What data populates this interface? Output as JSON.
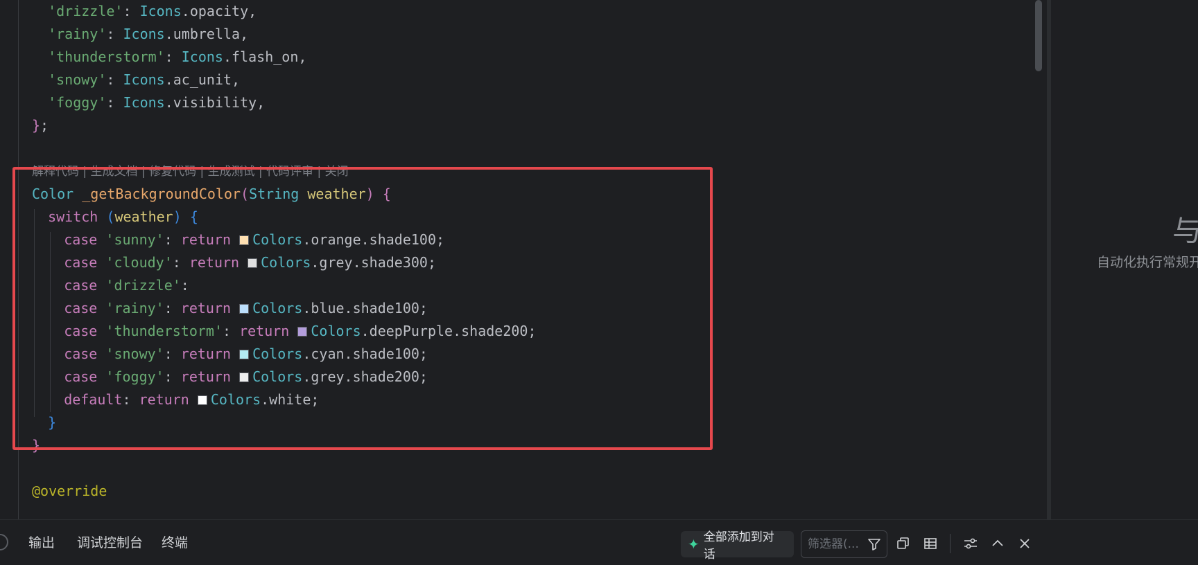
{
  "editor": {
    "codelens": "解释代码 | 生成文档 | 修复代码 | 生成测试 | 代码评审 | 关闭",
    "top_entries": [
      {
        "key": "'drizzle'",
        "cls": "Icons",
        "member": "opacity"
      },
      {
        "key": "'rainy'",
        "cls": "Icons",
        "member": "umbrella"
      },
      {
        "key": "'thunderstorm'",
        "cls": "Icons",
        "member": "flash_on"
      },
      {
        "key": "'snowy'",
        "cls": "Icons",
        "member": "ac_unit"
      },
      {
        "key": "'foggy'",
        "cls": "Icons",
        "member": "visibility"
      }
    ],
    "map_close": "};",
    "func": {
      "ret_type": "Color",
      "name": "_getBackgroundColor",
      "param_type": "String",
      "param_name": "weather"
    },
    "switch_kw": "switch",
    "switch_arg": "weather",
    "case_kw": "case",
    "return_kw": "return",
    "default_kw": "default",
    "cases": [
      {
        "label": "'sunny'",
        "has_return": true,
        "swatch": "#ffe0b2",
        "cls": "Colors",
        "member": "orange.shade100;"
      },
      {
        "label": "'cloudy'",
        "has_return": true,
        "swatch": "#e0e0e0",
        "cls": "Colors",
        "member": "grey.shade300;"
      },
      {
        "label": "'drizzle'",
        "has_return": false
      },
      {
        "label": "'rainy'",
        "has_return": true,
        "swatch": "#bbdefb",
        "cls": "Colors",
        "member": "blue.shade100;"
      },
      {
        "label": "'thunderstorm'",
        "has_return": true,
        "swatch": "#b39ddb",
        "cls": "Colors",
        "member": "deepPurple.shade200;"
      },
      {
        "label": "'snowy'",
        "has_return": true,
        "swatch": "#b2ebf2",
        "cls": "Colors",
        "member": "cyan.shade100;"
      },
      {
        "label": "'foggy'",
        "has_return": true,
        "swatch": "#eeeeee",
        "cls": "Colors",
        "member": "grey.shade200;"
      }
    ],
    "default_case": {
      "swatch": "#ffffff",
      "cls": "Colors",
      "member": "white;"
    },
    "annotation": "@override"
  },
  "right_panel": {
    "big_char": "与",
    "subtitle": "自动化执行常规开"
  },
  "bottom": {
    "tabs": [
      "输出",
      "调试控制台",
      "终端"
    ],
    "add_all_label": "全部添加到对话",
    "filter_placeholder": "筛选器(..."
  },
  "colors": {
    "highlight": "#e5484d",
    "background": "#1e1f22"
  }
}
